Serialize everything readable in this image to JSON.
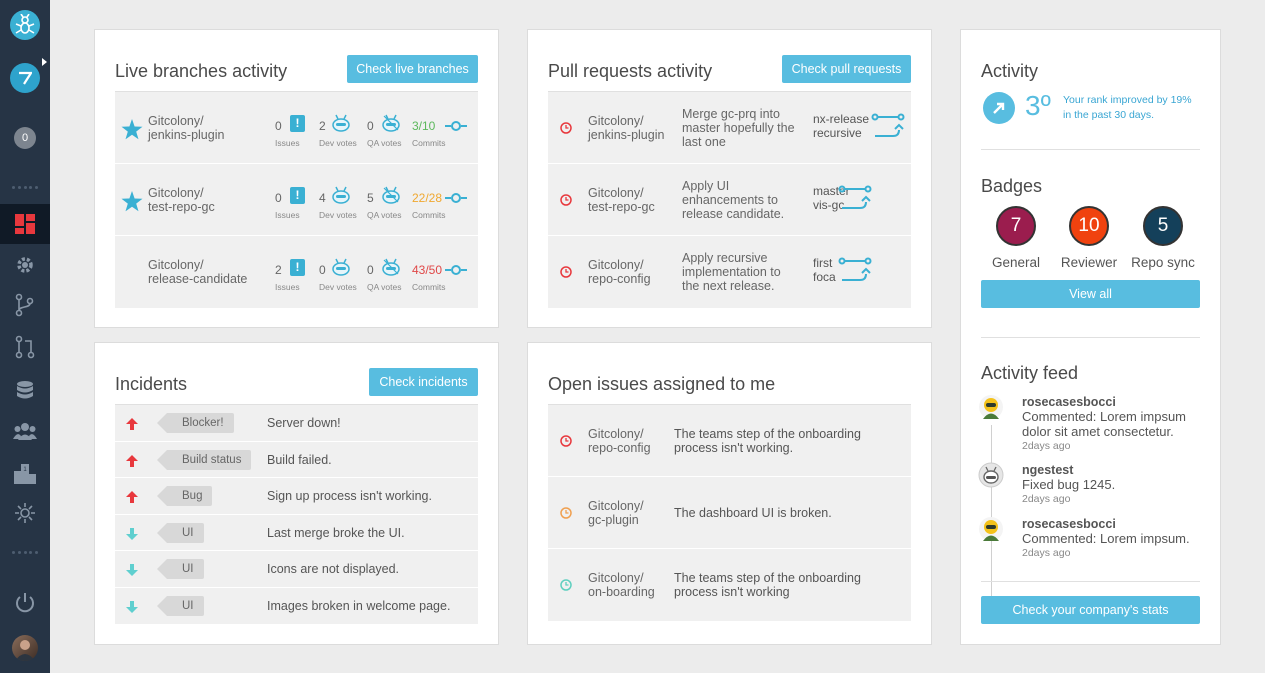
{
  "sidebar": {
    "notification_count": "0"
  },
  "live_branches": {
    "title": "Live branches activity",
    "button": "Check live branches",
    "labels": {
      "issues": "Issues",
      "dev_votes": "Dev votes",
      "qa_votes": "QA votes",
      "commits": "Commits"
    },
    "rows": [
      {
        "repo_line1": "Gitcolony/",
        "repo_line2": "jenkins-plugin",
        "starred": true,
        "issues": "0",
        "dev_votes": "2",
        "qa_votes": "0",
        "commits": "3/10",
        "commits_color": "#5cb85c"
      },
      {
        "repo_line1": "Gitcolony/",
        "repo_line2": "test-repo-gc",
        "starred": true,
        "issues": "0",
        "dev_votes": "4",
        "qa_votes": "5",
        "commits": "22/28",
        "commits_color": "#f0a830"
      },
      {
        "repo_line1": "Gitcolony/",
        "repo_line2": "release-candidate",
        "starred": false,
        "issues": "2",
        "dev_votes": "0",
        "qa_votes": "0",
        "commits": "43/50",
        "commits_color": "#e04848"
      }
    ]
  },
  "pull_requests": {
    "title": "Pull requests activity",
    "button": "Check pull requests",
    "rows": [
      {
        "repo_line1": "Gitcolony/",
        "repo_line2": "jenkins-plugin",
        "title_lines": [
          "Merge gc-prq into",
          "master hopefully the",
          "last one"
        ],
        "from": "nx-release",
        "to": "recursive"
      },
      {
        "repo_line1": "Gitcolony/",
        "repo_line2": "test-repo-gc",
        "title_lines": [
          "Apply UI",
          "enhancements to",
          "release candidate."
        ],
        "from": "master",
        "to": "vis-gc"
      },
      {
        "repo_line1": "Gitcolony/",
        "repo_line2": "repo-config",
        "title_lines": [
          "Apply recursive",
          "implementation to",
          "the next release."
        ],
        "from": "first",
        "to": "foca"
      }
    ]
  },
  "incidents": {
    "title": "Incidents",
    "button": "Check incidents",
    "rows": [
      {
        "tag": "Blocker!",
        "text": "Server down!",
        "direction": "up"
      },
      {
        "tag": "Build status",
        "text": "Build failed.",
        "direction": "up"
      },
      {
        "tag": "Bug",
        "text": "Sign up process isn't working.",
        "direction": "up"
      },
      {
        "tag": "UI",
        "text": "Last merge broke the UI.",
        "direction": "down"
      },
      {
        "tag": "UI",
        "text": "Icons are not displayed.",
        "direction": "down"
      },
      {
        "tag": "UI",
        "text": "Images broken in welcome page.",
        "direction": "down"
      }
    ],
    "colors": {
      "up": "#e8383d",
      "down": "#5fcfcf"
    }
  },
  "open_issues": {
    "title": "Open issues assigned to me",
    "rows": [
      {
        "repo_line1": "Gitcolony/",
        "repo_line2": "repo-config",
        "text_lines": [
          "The teams step of the onboarding",
          "process isn't working."
        ],
        "color": "#e8383d"
      },
      {
        "repo_line1": "Gitcolony/",
        "repo_line2": "gc-plugin",
        "text_lines": [
          "The dashboard UI is broken."
        ],
        "color": "#f0a050"
      },
      {
        "repo_line1": "Gitcolony/",
        "repo_line2": "on-boarding",
        "text_lines": [
          "The teams step of the onboarding",
          "process isn't working"
        ],
        "color": "#5fcfbf"
      }
    ]
  },
  "activity": {
    "title": "Activity",
    "rank": "3º",
    "rank_text_line1": "Your rank improved by 19%",
    "rank_text_line2": "in the past 30 days.",
    "badges_title": "Badges",
    "badges": [
      {
        "value": "7",
        "label": "General",
        "color": "#9b1d4e"
      },
      {
        "value": "10",
        "label": "Reviewer",
        "color": "#f0420f"
      },
      {
        "value": "5",
        "label": "Repo sync",
        "color": "#14405a"
      }
    ],
    "view_all": "View all",
    "feed_title": "Activity feed",
    "feed": [
      {
        "user": "rosecasesbocci",
        "msg_lines": [
          "Commented: Lorem impsum",
          "dolor sit amet consectetur."
        ],
        "time": "2days ago"
      },
      {
        "user": "ngestest",
        "msg_lines": [
          "Fixed bug 1245."
        ],
        "time": "2days ago"
      },
      {
        "user": "rosecasesbocci",
        "msg_lines": [
          "Commented: Lorem impsum."
        ],
        "time": "2days ago"
      }
    ],
    "stats_button": "Check your company's stats"
  }
}
